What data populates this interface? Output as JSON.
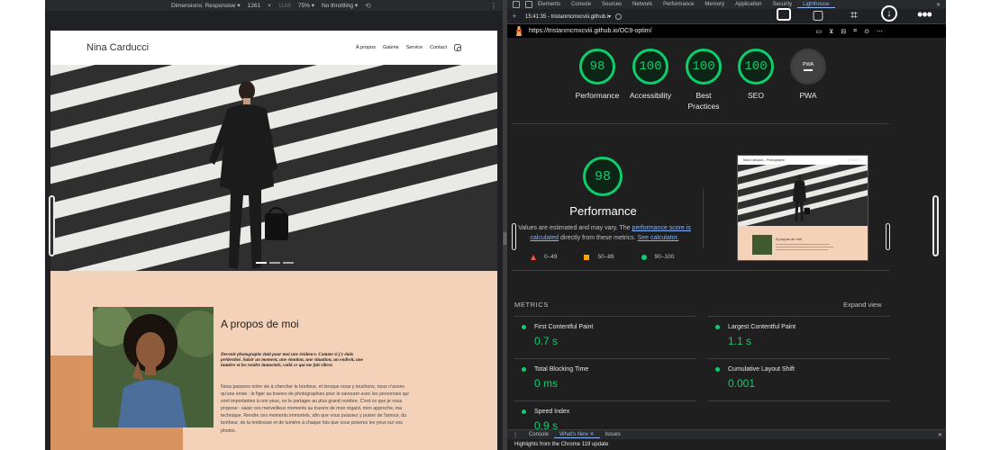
{
  "emulation": {
    "dimensions_label": "Dimensions: Responsive",
    "width": "1261",
    "times": "×",
    "height": "1168",
    "zoom": "75%",
    "throttling": "No throttling"
  },
  "site": {
    "title": "Nina Carducci",
    "nav": [
      "À propos",
      "Galerie",
      "Service",
      "Contact"
    ],
    "about_title": "A propos de moi",
    "about_quote": "Devenir photographe était pour moi une évidence. Comme si j'y étais prédestiné. Saisir un moment, une émotion, une situation, un endroit, une lumière et les rendre immortels, voilà ce qui me fait vibrer.",
    "about_body": "Nous passons notre vie à chercher le bonheur, et lorsque nous y touchons, nous n'avons qu'une envie : le figer au travers de photographies pour le savourer avec les personnes qui sont importantes à nos yeux, ou le partager au plus grand nombre. C'est ce que je vous propose : saisir ces merveilleux moments au travers de mon regard, mon approche, ma technique. Rendre ces moments immortels, afin que vous puissiez y puiser de l'amour, du bonheur, de la tendresse et de lumière à chaque fois que vous poserez les yeux sur vos photos."
  },
  "devtools": {
    "tabs": [
      "Elements",
      "Console",
      "Sources",
      "Network",
      "Performance",
      "Memory",
      "Application",
      "Security",
      "Lighthouse"
    ],
    "active_tab": "Lighthouse",
    "report_label": "15:41:35 - tristanmcmxcviii.github.i▾",
    "url": "https://tristanmcmxcviii.github.io/OC9-optim/",
    "scores": [
      {
        "value": "98",
        "label": "Performance"
      },
      {
        "value": "100",
        "label": "Accessibility"
      },
      {
        "value": "100",
        "label": "Best Practices"
      },
      {
        "value": "100",
        "label": "SEO"
      },
      {
        "value": "PWA",
        "label": "PWA"
      }
    ],
    "perf_score": "98",
    "perf_title": "Performance",
    "perf_note_1": "Values are estimated and may vary. The ",
    "perf_link_1": "performance score is calculated",
    "perf_note_2": " directly from these metrics. ",
    "perf_link_2": "See calculator.",
    "legend": [
      "0–49",
      "50–89",
      "90–100"
    ],
    "thumb_title": "Nina Carducci – Photographe",
    "thumb_about": "A propos de moi",
    "metrics_heading": "METRICS",
    "expand_label": "Expand view",
    "metrics": [
      {
        "label": "First Contentful Paint",
        "value": "0.7 s"
      },
      {
        "label": "Largest Contentful Paint",
        "value": "1.1 s"
      },
      {
        "label": "Total Blocking Time",
        "value": "0 ms"
      },
      {
        "label": "Cumulative Layout Shift",
        "value": "0.001"
      },
      {
        "label": "Speed Index",
        "value": "0.9 s"
      }
    ],
    "drawer_tabs": [
      "Console",
      "What's New",
      "Issues"
    ],
    "drawer_active": "What's New",
    "highlights": "Highlights from the Chrome 119 update"
  },
  "colors": {
    "pass": "#0cce6b",
    "average": "#ffa400",
    "fail": "#ff4e42",
    "link": "#8ab4f8",
    "about_bg": "#f4d1b9"
  }
}
